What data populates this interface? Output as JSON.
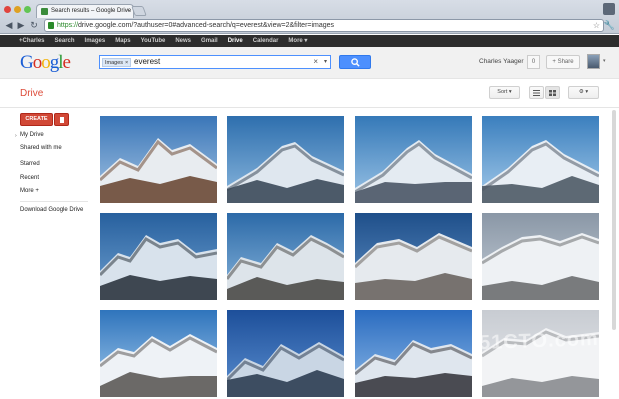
{
  "browser": {
    "tab_title": "Search results – Google Drive",
    "tab_close": "×",
    "url_https": "https://",
    "url_rest": "drive.google.com/?authuser=0#advanced-search/q=everest&view=2&filter=images"
  },
  "gbar": {
    "items": [
      "+Charles",
      "Search",
      "Images",
      "Maps",
      "YouTube",
      "News",
      "Gmail",
      "Drive",
      "Calendar",
      "More ▾"
    ],
    "selected_index": 7
  },
  "header": {
    "logo_letters": [
      "G",
      "o",
      "o",
      "g",
      "l",
      "e"
    ],
    "logo_colors": [
      "#1a5dd5",
      "#d62d20",
      "#f2b50f",
      "#1a5dd5",
      "#2e9a39",
      "#d62d20"
    ],
    "search_chip": "Images",
    "search_chip_close": "×",
    "search_query": "everest",
    "clear_glyph": "×",
    "dropdown_glyph": "▾",
    "user_name": "Charles Yaager",
    "notification_count": "0",
    "share_label": "+ Share",
    "avatar_dropdown": "▾"
  },
  "toolbar": {
    "title": "Drive",
    "sort_label": "Sort",
    "sort_dd": "▾",
    "list_view_icon": "list-view-icon",
    "grid_view_icon": "grid-view-icon",
    "settings_icon": "gear-icon",
    "settings_dd": "▾"
  },
  "sidebar": {
    "create_label": "CREATE",
    "items": [
      "My Drive",
      "Shared with me",
      "Starred",
      "Recent",
      "More +",
      "Download Google Drive"
    ],
    "expand_glyph": "›"
  },
  "grid": {
    "images": [
      {
        "name": "everest-image-01",
        "sky": "#3a76b8",
        "sky2": "#a8c6e4",
        "rock": "#6b4a36",
        "snow": "#e8ecf0"
      },
      {
        "name": "everest-image-02",
        "sky": "#2e6fae",
        "sky2": "#8cb8de",
        "rock": "#3c4a5a",
        "snow": "#dfe7ef"
      },
      {
        "name": "everest-image-03",
        "sky": "#3579b8",
        "sky2": "#9cc4e6",
        "rock": "#4a5766",
        "snow": "#e4ebf2"
      },
      {
        "name": "everest-image-04",
        "sky": "#3b7fbe",
        "sky2": "#a5cbea",
        "rock": "#4e5a66",
        "snow": "#e8eef4"
      },
      {
        "name": "everest-image-05",
        "sky": "#27609e",
        "sky2": "#6fa0d0",
        "rock": "#2e3640",
        "snow": "#d8e2ec"
      },
      {
        "name": "everest-image-06",
        "sky": "#2c6aa8",
        "sky2": "#8ab6dc",
        "rock": "#4b4a48",
        "snow": "#dde4ea"
      },
      {
        "name": "everest-image-07",
        "sky": "#1f4f8a",
        "sky2": "#5e8fc4",
        "rock": "#6a6560",
        "snow": "#e6eaee"
      },
      {
        "name": "everest-image-08",
        "sky": "#8a97a6",
        "sky2": "#c5ced8",
        "rock": "#6b6e70",
        "snow": "#eef1f4"
      },
      {
        "name": "everest-image-09",
        "sky": "#2f74bc",
        "sky2": "#a6cdee",
        "rock": "#5c5a58",
        "snow": "#eef2f6"
      },
      {
        "name": "everest-image-10",
        "sky": "#1d4f9a",
        "sky2": "#5b8fd0",
        "rock": "#2d3e52",
        "snow": "#c9d6e4"
      },
      {
        "name": "everest-image-11",
        "sky": "#2b6cc0",
        "sky2": "#8fbbe8",
        "rock": "#3a3a40",
        "snow": "#dfe6ee"
      },
      {
        "name": "everest-image-12",
        "sky": "#c8ccd2",
        "sky2": "#e8eaee",
        "rock": "#8a8c90",
        "snow": "#f2f3f5"
      }
    ]
  },
  "watermark": "51CTO.com"
}
